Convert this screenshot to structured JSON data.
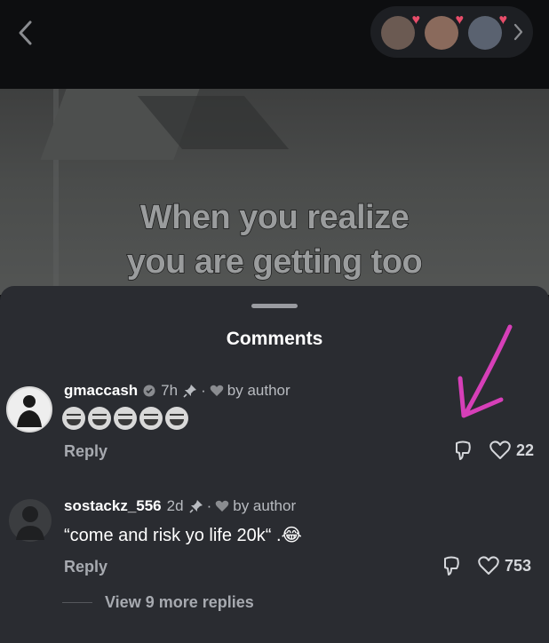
{
  "video": {
    "caption_line1": "When you realize",
    "caption_line2": "you are getting too"
  },
  "topbar": {
    "back_icon": "chevron-left-icon",
    "liked_by_avatars": 3
  },
  "comments_sheet": {
    "title": "Comments",
    "comments": [
      {
        "username": "gmaccash",
        "time": "7h",
        "liked_by": "by author",
        "text": "😂😂😂😂😂",
        "reply_label": "Reply",
        "like_count": "22"
      },
      {
        "username": "sostackz_556",
        "time": "2d",
        "liked_by": "by author",
        "text": "“come and risk yo life 20k“ .😂",
        "reply_label": "Reply",
        "like_count": "753"
      }
    ],
    "view_more": "View 9 more replies"
  },
  "colors": {
    "sheet_bg": "#2a2c31",
    "annotation_arrow": "#d63fb8",
    "pill_heart": "#e84d6a"
  }
}
